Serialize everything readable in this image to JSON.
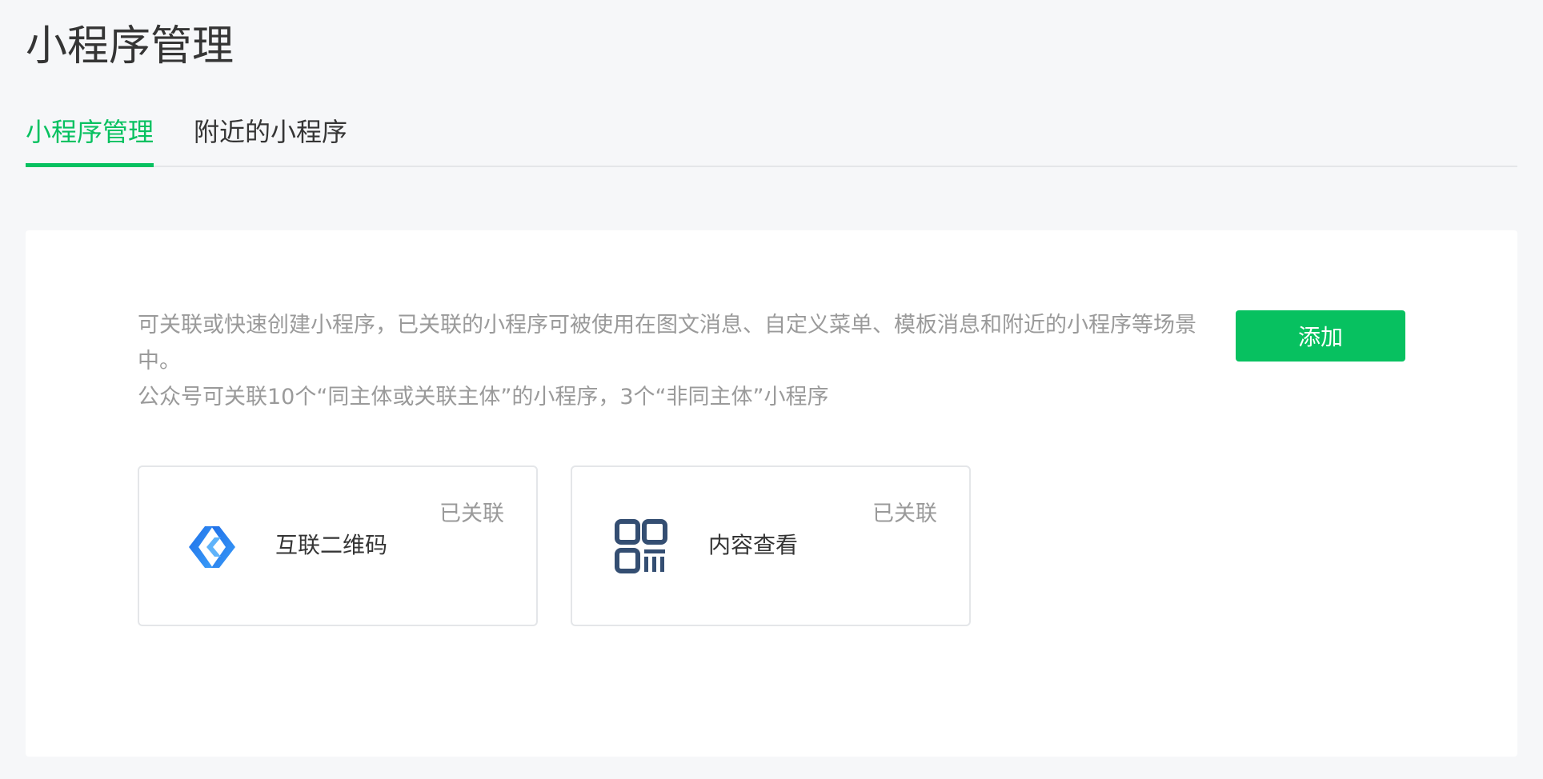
{
  "page": {
    "title": "小程序管理"
  },
  "tabs": [
    {
      "label": "小程序管理",
      "active": true
    },
    {
      "label": "附近的小程序",
      "active": false
    }
  ],
  "panel": {
    "description_line1": "可关联或快速创建小程序，已关联的小程序可被使用在图文消息、自定义菜单、模板消息和附近的小程序等场景中。",
    "description_line2": "公众号可关联10个“同主体或关联主体”的小程序，3个“非同主体”小程序",
    "add_button_label": "添加",
    "cards": [
      {
        "name": "互联二维码",
        "status": "已关联",
        "icon": "chain-link-icon"
      },
      {
        "name": "内容查看",
        "status": "已关联",
        "icon": "qr-code-icon"
      }
    ]
  },
  "colors": {
    "accent": "#07c160",
    "background": "#f6f7f9",
    "muted_text": "#9a9a9a",
    "primary_text": "#353535",
    "link_icon_blue": "#2b7ef3",
    "qr_icon_navy": "#344e72"
  }
}
